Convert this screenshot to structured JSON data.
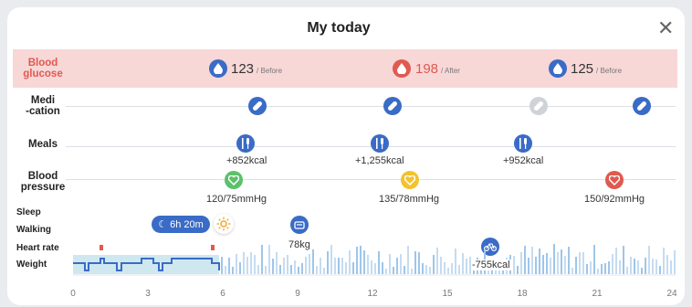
{
  "header": {
    "title": "My today",
    "close_icon": "close-icon"
  },
  "rows": {
    "blood_glucose": "Blood\nglucose",
    "medication": "Medi\n-cation",
    "meals": "Meals",
    "blood_pressure": "Blood\npressure",
    "sleep": "Sleep",
    "walking": "Walking",
    "heart_rate": "Heart rate",
    "weight": "Weight"
  },
  "glucose": [
    {
      "value": "123",
      "tag": "/ Before",
      "color": "#3a6bc6"
    },
    {
      "value": "198",
      "tag": "/ After",
      "color": "#e05a4f"
    },
    {
      "value": "125",
      "tag": "/ Before",
      "color": "#3a6bc6"
    }
  ],
  "meals": [
    "+852kcal",
    "+1,255kcal",
    "+952kcal"
  ],
  "blood_pressure": [
    {
      "value": "120/75mmHg",
      "color": "#5cc16a"
    },
    {
      "value": "135/78mmHg",
      "color": "#f2c230"
    },
    {
      "value": "150/92mmHg",
      "color": "#e05a4f"
    }
  ],
  "sleep": {
    "duration": "6h 20m"
  },
  "weight": {
    "value": "78kg"
  },
  "exercise": {
    "value": "-755kcal"
  },
  "x_axis": [
    "0",
    "3",
    "6",
    "9",
    "12",
    "15",
    "18",
    "21",
    "24"
  ],
  "colors": {
    "accent": "#3a6bc6",
    "glucose_band": "#f8d7d7",
    "inactive": "#cfd3d8"
  }
}
